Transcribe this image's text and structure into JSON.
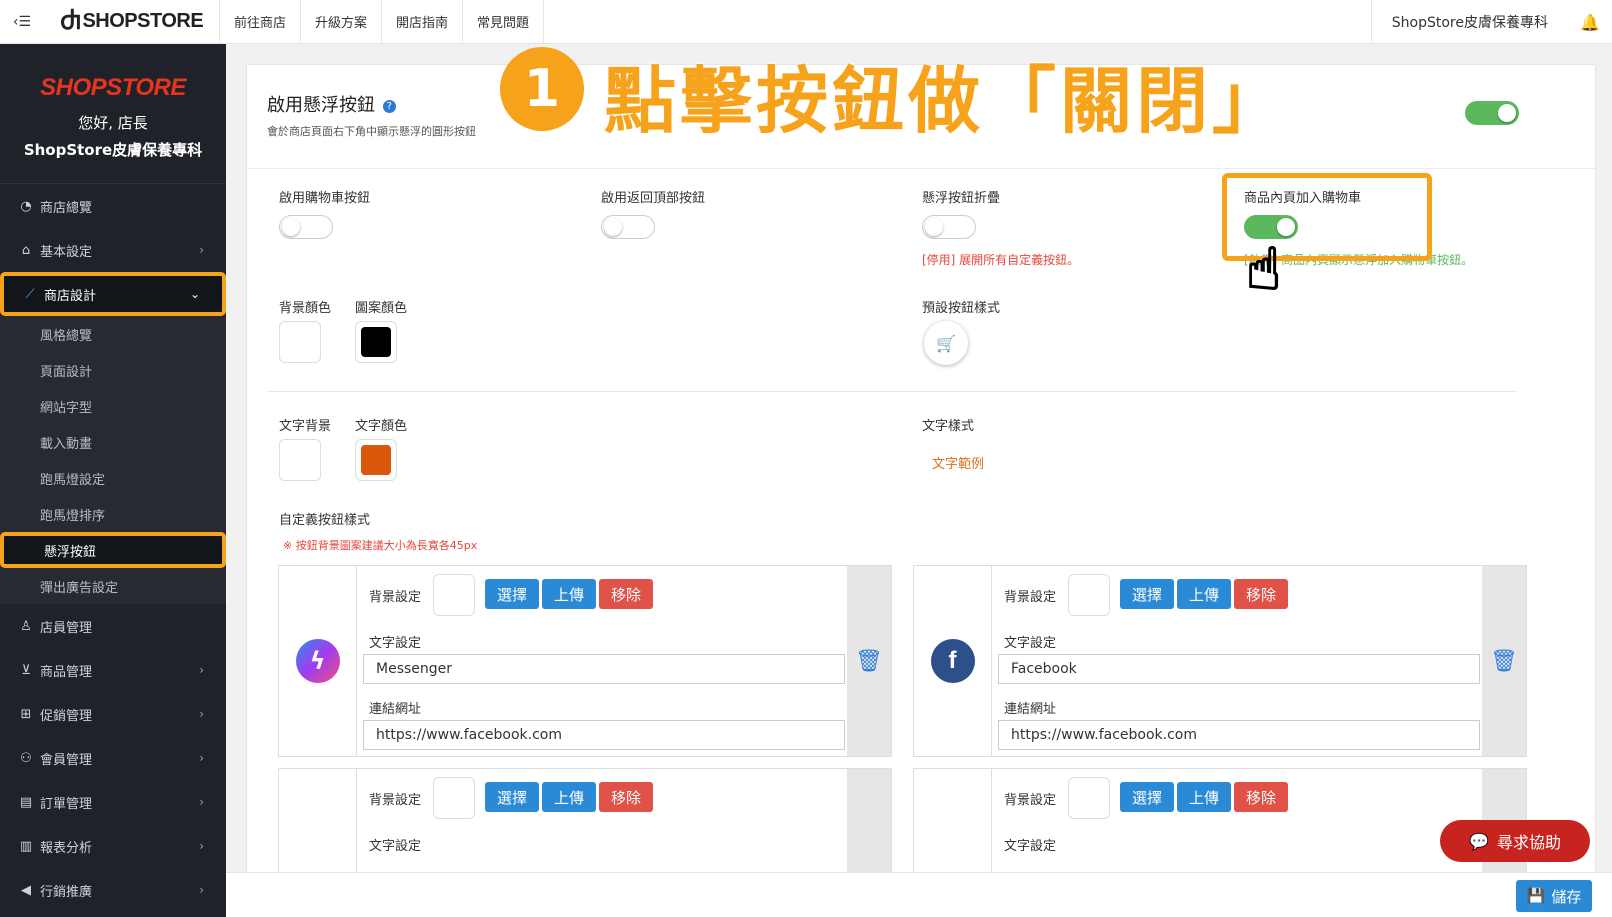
{
  "topbar": {
    "menu_icon": "menu-icon",
    "logo_text": "SHOPSTORE",
    "links": [
      "前往商店",
      "升級方案",
      "開店指南",
      "常見問題"
    ],
    "store_name": "ShopStore皮膚保養專科",
    "bell_icon": "bell-icon"
  },
  "sidebar": {
    "brand_logo": "SHOPSTORE",
    "greeting": "您好, 店長",
    "store_name": "ShopStore皮膚保養專科",
    "items": [
      {
        "label": "商店總覽",
        "icon": "dashboard-icon",
        "chev": ""
      },
      {
        "label": "基本設定",
        "icon": "bank-icon",
        "chev": "›"
      },
      {
        "label": "商店設計",
        "icon": "magic-wand-icon",
        "chev": "⌄"
      },
      {
        "label": "店員管理",
        "icon": "user-lock-icon",
        "chev": ""
      },
      {
        "label": "商品管理",
        "icon": "cart-icon",
        "chev": "›"
      },
      {
        "label": "促銷管理",
        "icon": "gift-icon",
        "chev": "›"
      },
      {
        "label": "會員管理",
        "icon": "users-icon",
        "chev": "›"
      },
      {
        "label": "訂單管理",
        "icon": "order-icon",
        "chev": "›"
      },
      {
        "label": "報表分析",
        "icon": "chart-icon",
        "chev": "›"
      },
      {
        "label": "行銷推廣",
        "icon": "megaphone-icon",
        "chev": "›"
      }
    ],
    "sub_items": [
      "風格總覽",
      "頁面設計",
      "網站字型",
      "載入動畫",
      "跑馬燈設定",
      "跑馬燈排序",
      "懸浮按鈕",
      "彈出廣告設定"
    ]
  },
  "callout": {
    "number": "1",
    "text": "點擊按鈕做「關閉」"
  },
  "card": {
    "title": "啟用懸浮按鈕",
    "description": "會於商店頁面右下角中顯示懸浮的圓形按鈕",
    "main_toggle": true
  },
  "options": {
    "cart_btn_label": "啟用購物車按鈕",
    "cart_btn_on": false,
    "top_btn_label": "啟用返回頂部按鈕",
    "top_btn_on": false,
    "collapse_label": "懸浮按鈕折疊",
    "collapse_on": false,
    "collapse_hint": "[停用] 展開所有自定義按鈕。",
    "product_cart_label": "商品內頁加入購物車",
    "product_cart_on": true,
    "product_cart_hint": "[啟用] 商品內頁顯示懸浮加入購物車按鈕。"
  },
  "colors": {
    "bg_color_label": "背景顏色",
    "pattern_color_label": "圖案顏色",
    "bg_color": "#ffffff",
    "pattern_color": "#000000",
    "default_style_label": "預設按鈕樣式",
    "text_bg_label": "文字背景",
    "text_color_label": "文字顏色",
    "text_bg": "#ffffff",
    "text_color": "#d9580b",
    "text_style_label": "文字樣式",
    "text_sample": "文字範例"
  },
  "custom": {
    "title": "自定義按鈕樣式",
    "note": "※ 按鈕背景圖案建議大小為長寬各45px",
    "bg_setting_label": "背景設定",
    "text_setting_label": "文字設定",
    "url_label": "連結網址",
    "select_label": "選擇",
    "upload_label": "上傳",
    "remove_label": "移除",
    "rows": [
      {
        "text": "Messenger",
        "url": "https://www.facebook.com",
        "icon": "messenger-icon"
      },
      {
        "text": "Facebook",
        "url": "https://www.facebook.com",
        "icon": "facebook-icon"
      }
    ]
  },
  "help_label": "尋求協助",
  "save_label": "儲存"
}
